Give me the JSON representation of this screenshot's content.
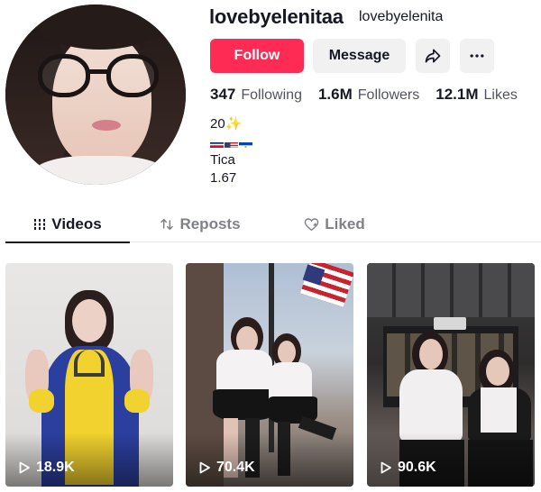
{
  "profile": {
    "username": "lovebyelenitaa",
    "nickname": "lovebyelenita",
    "avatar_icon": "profile-photo"
  },
  "actions": {
    "follow_label": "Follow",
    "message_label": "Message",
    "share_icon": "share-arrow-icon",
    "more_icon": "more-dots-icon"
  },
  "stats": {
    "following_count": "347",
    "following_label": "Following",
    "followers_count": "1.6M",
    "followers_label": "Followers",
    "likes_count": "12.1M",
    "likes_label": "Likes"
  },
  "bio": {
    "line1": "20✨",
    "flags": [
      "costa-rica-flag",
      "usa-flag",
      "el-salvador-flag"
    ],
    "line3": "Tica",
    "line4": "1.67"
  },
  "tabs": [
    {
      "label": "Videos",
      "icon": "grid-bars-icon",
      "active": true
    },
    {
      "label": "Reposts",
      "icon": "repost-icon",
      "active": false
    },
    {
      "label": "Liked",
      "icon": "heart-outline-icon",
      "active": false
    }
  ],
  "videos": [
    {
      "views": "18.9K"
    },
    {
      "views": "70.4K"
    },
    {
      "views": "90.6K"
    }
  ],
  "colors": {
    "accent": "#fe2c55",
    "text": "#161823",
    "button_gray": "#f1f1f2"
  }
}
